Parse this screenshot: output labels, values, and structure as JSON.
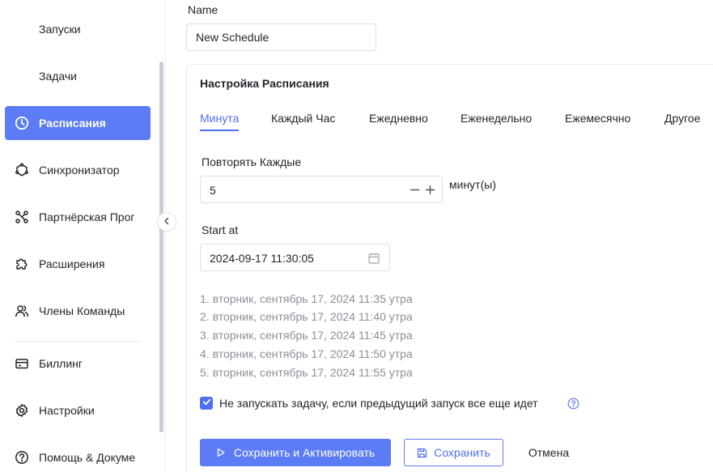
{
  "sidebar": {
    "items": [
      {
        "label": "Запуски",
        "icon": "none"
      },
      {
        "label": "Задачи",
        "icon": "none"
      },
      {
        "label": "Расписания",
        "icon": "clock-icon",
        "active": true
      },
      {
        "label": "Синхронизатор",
        "icon": "sync-icon"
      },
      {
        "label": "Партнёрская Прог",
        "icon": "partner-icon"
      },
      {
        "label": "Расширения",
        "icon": "puzzle-icon"
      },
      {
        "label": "Члены Команды",
        "icon": "team-icon"
      },
      {
        "label": "Биллинг",
        "icon": "card-icon"
      },
      {
        "label": "Настройки",
        "icon": "gear-icon"
      },
      {
        "label": "Помощь & Докуме",
        "icon": "help-icon"
      }
    ]
  },
  "form": {
    "name_label": "Name",
    "name_value": "New Schedule"
  },
  "schedule": {
    "title": "Настройка Расписания",
    "tabs": [
      "Минута",
      "Каждый Час",
      "Ежедневно",
      "Еженедельно",
      "Ежемесячно",
      "Другое"
    ],
    "active_tab": "Минута",
    "repeat_label": "Повторять Каждые",
    "repeat_value": "5",
    "repeat_unit": "минут(ы)",
    "start_label": "Start at",
    "start_value": "2024-09-17 11:30:05",
    "next_runs": [
      "1. вторник, сентябрь 17, 2024 11:35 утра",
      "2. вторник, сентябрь 17, 2024 11:40 утра",
      "3. вторник, сентябрь 17, 2024 11:45 утра",
      "4. вторник, сентябрь 17, 2024 11:50 утра",
      "5. вторник, сентябрь 17, 2024 11:55 утра"
    ],
    "skip_label": "Не запускать задачу, если предыдущий запуск все еще идет",
    "skip_checked": true
  },
  "actions": {
    "save_activate": "Сохранить и Активировать",
    "save": "Сохранить",
    "cancel": "Отмена"
  },
  "colors": {
    "accent": "#5b7cf5",
    "muted_text": "#8a8f98"
  }
}
